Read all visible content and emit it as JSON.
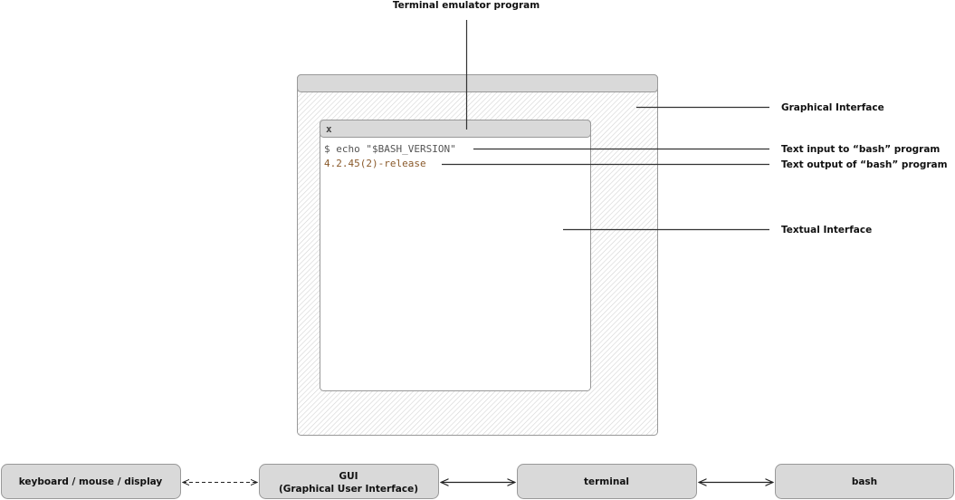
{
  "labels": {
    "terminal_emulator": "Terminal emulator program",
    "graphical_interface": "Graphical Interface",
    "text_input": "Text input to “bash” program",
    "text_output": "Text output of “bash” program",
    "textual_interface": "Textual Interface"
  },
  "terminal": {
    "close_label": "x",
    "input_line": "$ echo \"$BASH_VERSION\"",
    "output_line": "4.2.45(2)-release"
  },
  "flow": {
    "nodes": [
      {
        "line1": "keyboard / mouse / display"
      },
      {
        "line1": "GUI",
        "line2": "(Graphical User Interface)"
      },
      {
        "line1": "terminal"
      },
      {
        "line1": "bash"
      }
    ],
    "links": [
      "dashed bidirectional",
      "solid bidirectional",
      "solid bidirectional"
    ]
  },
  "colors": {
    "box_fill": "#d9d9d9",
    "border": "#999999",
    "input_text": "#555555",
    "output_text": "#8a5a2b"
  }
}
